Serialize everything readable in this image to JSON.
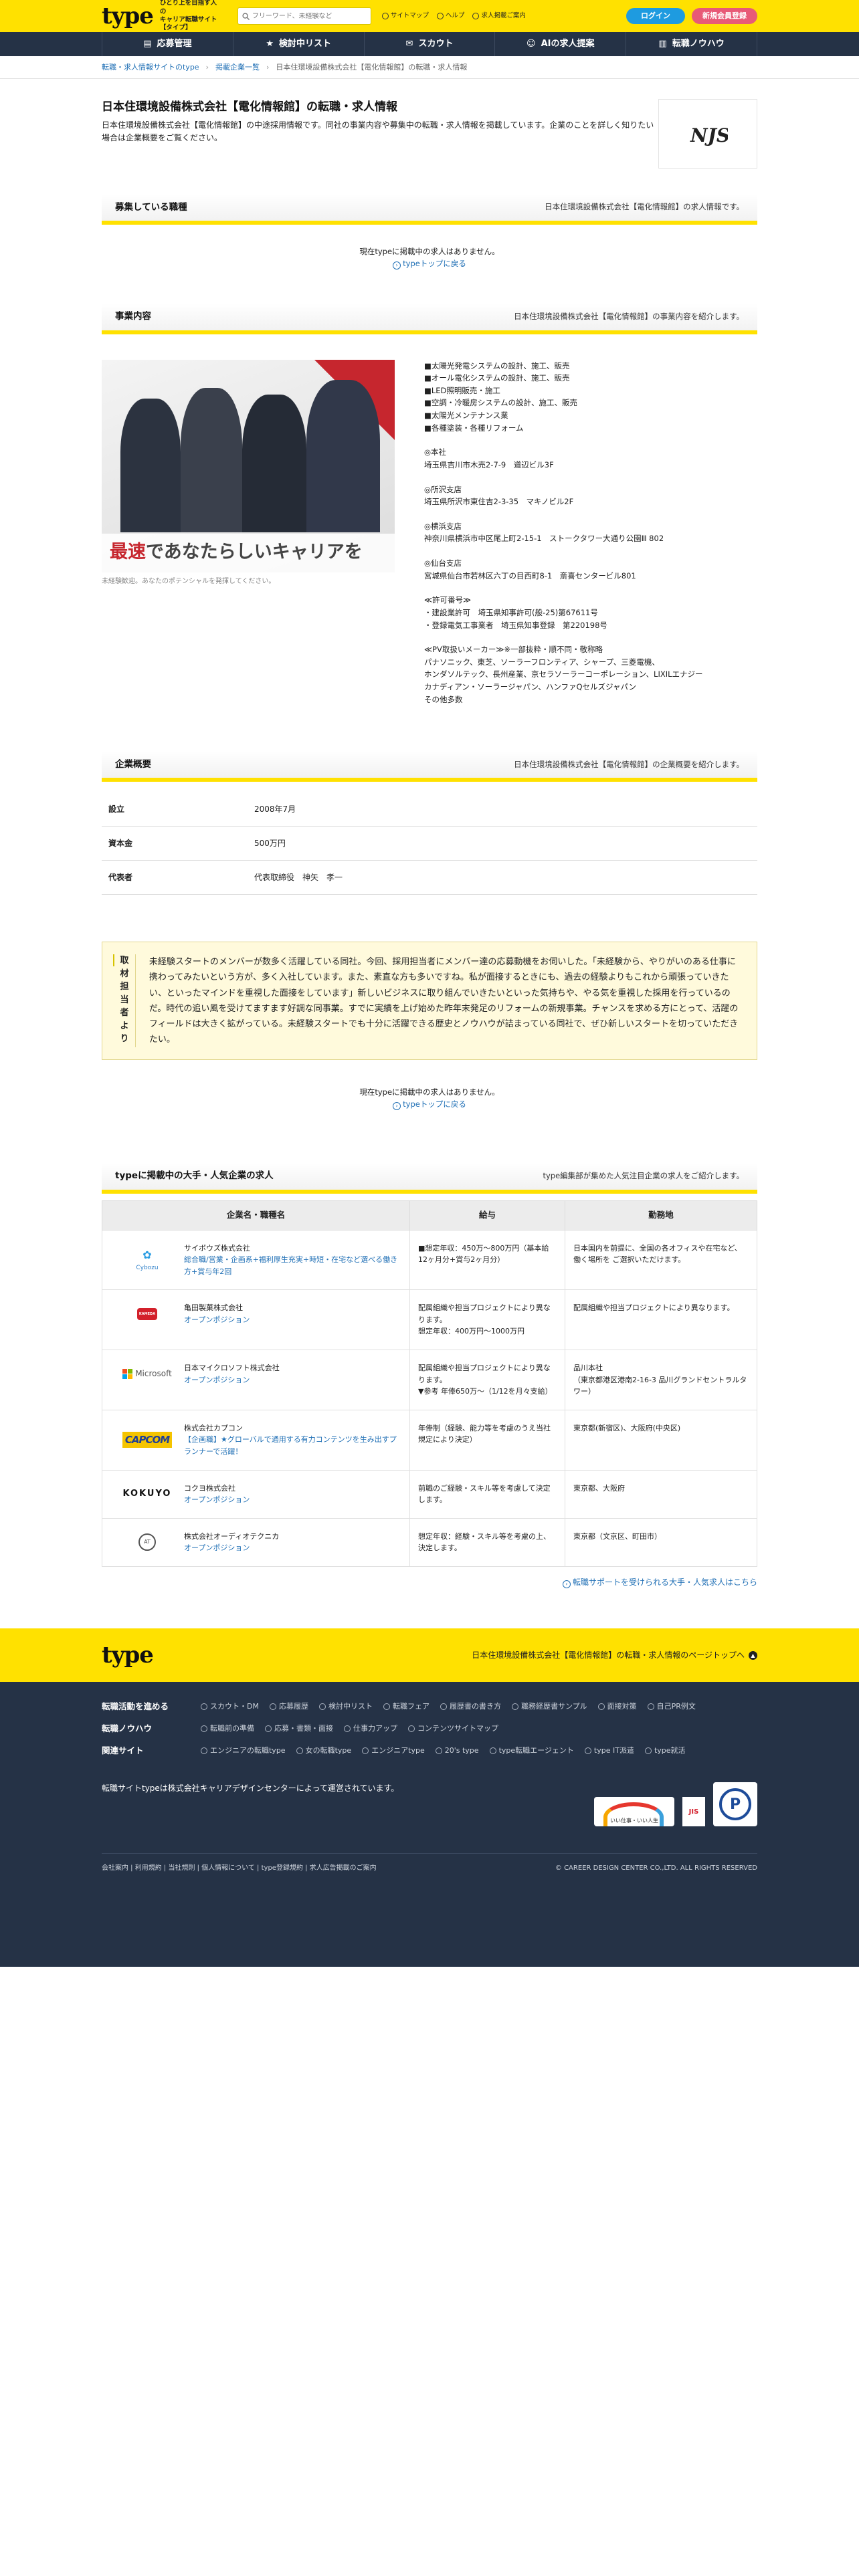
{
  "header": {
    "logo": "type",
    "tagline_1": "ひとり上を目指す人の",
    "tagline_2": "キャリア転職サイト【タイプ】",
    "search_placeholder": "フリーワード、未経験など",
    "links": [
      "サイトマップ",
      "ヘルプ",
      "求人掲載ご案内"
    ],
    "login": "ログイン",
    "register": "新規会員登録"
  },
  "nav": [
    "応募管理",
    "検討中リスト",
    "スカウト",
    "AIの求人提案",
    "転職ノウハウ"
  ],
  "breadcrumb": [
    "転職・求人情報サイトのtype",
    "掲載企業一覧",
    "日本住環境設備株式会社【電化情報館】の転職・求人情報"
  ],
  "company": {
    "title": "日本住環境設備株式会社【電化情報館】の転職・求人情報",
    "description": "日本住環境設備株式会社【電化情報館】の中途採用情報です。同社の事業内容や募集中の転職・求人情報を掲載しています。企業のことを詳しく知りたい場合は企業概要をご覧ください。",
    "logo_text": "NJS"
  },
  "jobs_section": {
    "title": "募集している職種",
    "right": "日本住環境設備株式会社【電化情報館】の求人情報です。",
    "empty": "現在typeに掲載中の求人はありません。",
    "back": "typeトップに戻る"
  },
  "business": {
    "title": "事業内容",
    "right": "日本住環境設備株式会社【電化情報館】の事業内容を紹介します。",
    "banner_red": "最速",
    "banner_rest": "であなたらしいキャリアを",
    "caption": "未経験歓迎。あなたのポテンシャルを発揮してください。",
    "lines": [
      "■太陽光発電システムの設計、施工、販売",
      "■オール電化システムの設計、施工、販売",
      "■LED照明販売・施工",
      "■空調・冷暖房システムの設計、施工、販売",
      "■太陽光メンテナンス業",
      "■各種塗装・各種リフォーム",
      "",
      "◎本社",
      "埼玉県吉川市木売2-7-9　道辺ビル3F",
      "",
      "◎所沢支店",
      "埼玉県所沢市東住吉2-3-35　マキノビル2F",
      "",
      "◎横浜支店",
      "神奈川県横浜市中区尾上町2-15-1　ストークタワー大通り公園Ⅲ 802",
      "",
      "◎仙台支店",
      "宮城県仙台市若林区六丁の目西町8-1　斎喜センタービル801",
      "",
      "≪許可番号≫",
      "・建設業許可　埼玉県知事許可(般-25)第67611号",
      "・登録電気工事業者　埼玉県知事登録　第220198号",
      "",
      "≪PV取扱いメーカー≫※一部抜粋・順不同・敬称略",
      "パナソニック、東芝、ソーラーフロンティア、シャープ、三菱電機、",
      "ホンダソルテック、長州産業、京セラソーラーコーポレーション、LIXILエナジー",
      "カナディアン・ソーラージャパン、ハンファQセルズジャパン",
      "その他多数"
    ]
  },
  "overview": {
    "title": "企業概要",
    "right": "日本住環境設備株式会社【電化情報館】の企業概要を紹介します。",
    "rows": [
      {
        "k": "設立",
        "v": "2008年7月"
      },
      {
        "k": "資本金",
        "v": "500万円"
      },
      {
        "k": "代表者",
        "v": "代表取締役　神矢　孝一"
      }
    ]
  },
  "interview": {
    "label": "取材担当者より",
    "text": "未経験スタートのメンバーが数多く活躍している同社。今回、採用担当者にメンバー達の応募動機をお伺いした。「未経験から、やりがいのある仕事に携わってみたいという方が、多く入社しています。また、素直な方も多いですね。私が面接するときにも、過去の経験よりもこれから頑張っていきたい、といったマインドを重視した面接をしています」新しいビジネスに取り組んでいきたいといった気持ちや、やる気を重視した採用を行っているのだ。時代の追い風を受けてますます好調な同事業。すでに実績を上げ始めた昨年末発足のリフォームの新規事業。チャンスを求める方にとって、活躍のフィールドは大きく拡がっている。未経験スタートでも十分に活躍できる歴史とノウハウが詰まっている同社で、ぜひ新しいスタートを切っていただきたい。"
  },
  "empty2": {
    "empty": "現在typeに掲載中の求人はありません。",
    "back": "typeトップに戻る"
  },
  "popular": {
    "title": "typeに掲載中の大手・人気企業の求人",
    "right": "type編集部が集めた人気注目企業の求人をご紹介します。",
    "headers": [
      "企業名・職種名",
      "給与",
      "勤務地"
    ],
    "rows": [
      {
        "logo": "Cybozu",
        "company": "サイボウズ株式会社",
        "job": "総合職/営業・企画系+福利厚生充実+時短・在宅など選べる働き方+賞与年2回",
        "salary": "■想定年収：450万〜800万円（基本給12ヶ月分+賞与2ヶ月分）",
        "place": "日本国内を前提に、全国の各オフィスや在宅など、働く場所を ご選択いただけます。"
      },
      {
        "logo": "KAMEDA",
        "company": "亀田製菓株式会社",
        "job": "オープンポジション",
        "salary": "配属組織や担当プロジェクトにより異なります。\n想定年収：400万円〜1000万円",
        "place": "配属組織や担当プロジェクトにより異なります。"
      },
      {
        "logo": "Microsoft",
        "company": "日本マイクロソフト株式会社",
        "job": "オープンポジション",
        "salary": "配属組織や担当プロジェクトにより異なります。\n▼参考 年俸650万〜（1/12を月々支給）",
        "place": "品川本社\n（東京都港区港南2-16-3 品川グランドセントラルタワー）"
      },
      {
        "logo": "CAPCOM",
        "company": "株式会社カプコン",
        "job": "【企画職】★グローバルで通用する有力コンテンツを生み出すプランナーで活躍！",
        "salary": "年俸制（経験、能力等を考慮のうえ当社規定により決定）",
        "place": "東京都(新宿区)、大阪府(中央区)"
      },
      {
        "logo": "KOKUYO",
        "company": "コクヨ株式会社",
        "job": "オープンポジション",
        "salary": "前職のご経験・スキル等を考慮して決定します。",
        "place": "東京都、大阪府"
      },
      {
        "logo": "AT",
        "company": "株式会社オーディオテクニカ",
        "job": "オープンポジション",
        "salary": "想定年収：経験・スキル等を考慮の上、決定します。",
        "place": "東京都（文京区、町田市）"
      }
    ],
    "more": "転職サポートを受けられる大手・人気求人はこちら"
  },
  "footer": {
    "logo": "type",
    "right": "日本住環境設備株式会社【電化情報館】の転職・求人情報のページトップへ",
    "rows": [
      {
        "h": "転職活動を進める",
        "items": [
          "スカウト・DM",
          "応募履歴",
          "検討中リスト",
          "転職フェア",
          "履歴書の書き方",
          "職務経歴書サンプル",
          "面接対策",
          "自己PR例文"
        ]
      },
      {
        "h": "転職ノウハウ",
        "items": [
          "転職前の準備",
          "応募・書類・面接",
          "仕事力アップ",
          "コンテンツサイトマップ"
        ]
      },
      {
        "h": "関連サイト",
        "items": [
          "エンジニアの転職type",
          "女の転職type",
          "エンジニアtype",
          "20's type",
          "type転職エージェント",
          "type IT派遣",
          "type就活"
        ]
      }
    ],
    "note": "転職サイトtypeは株式会社キャリアデザインセンターによって運営されています。",
    "badge1": "いい仕事・いい人生",
    "badge2": "JIS",
    "badge3": "P",
    "bottom_links": "会社案内 | 利用規約 | 当社規則 | 個人情報について | type登録規約 | 求人広告掲載のご案内",
    "copyright": "© CAREER DESIGN CENTER CO.,LTD. ALL RIGHTS RESERVED"
  }
}
